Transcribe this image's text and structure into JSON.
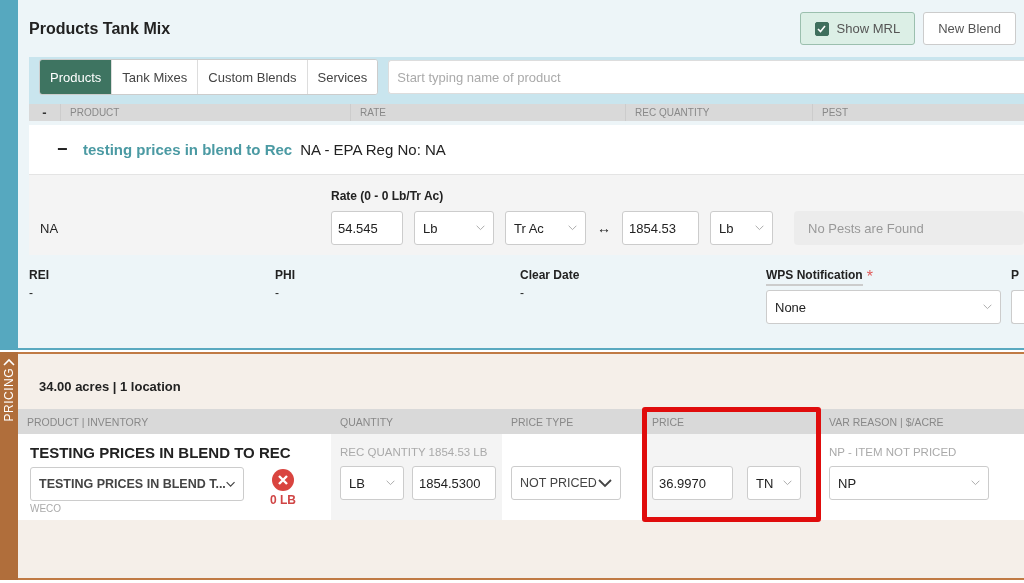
{
  "title": "Products Tank Mix",
  "header_buttons": [
    {
      "kind": "checkbox",
      "label": "Show MRL",
      "checked": true
    },
    {
      "kind": "button",
      "label": "New Blend"
    }
  ],
  "tabs": [
    {
      "label": "Products",
      "selected": true
    },
    {
      "label": "Tank Mixes",
      "selected": false
    },
    {
      "label": "Custom Blends",
      "selected": false
    },
    {
      "label": "Services",
      "selected": false
    }
  ],
  "search": {
    "placeholder": "Start typing name of product"
  },
  "product_table": {
    "collapse": "-",
    "columns": [
      "PRODUCT",
      "RATE",
      "REC QUANTITY",
      "PEST"
    ],
    "group": {
      "toggle": "−",
      "name": "testing prices in blend to Rec",
      "registration": "NA - EPA Reg No: NA"
    },
    "row": {
      "product": "NA",
      "rate_label": "Rate (0 - 0 Lb/Tr Ac)",
      "rate": "54.545",
      "rate_unit": "Lb",
      "area_unit": "Tr Ac",
      "link": "↔",
      "quantity": "1854.53",
      "quantity_unit": "Lb",
      "pests": "No Pests are Found"
    }
  },
  "details": [
    {
      "label": "REI",
      "value": "-"
    },
    {
      "label": "PHI",
      "value": "-"
    },
    {
      "label": "Clear Date",
      "value": "-"
    }
  ],
  "wps": {
    "label": "WPS Notification",
    "required_mark": "*",
    "value": "None"
  },
  "cut_field": {
    "label": "P"
  },
  "pricing": {
    "tab": "PRICING",
    "summary": "34.00 acres | 1 location",
    "columns": [
      {
        "label": "PRODUCT | INVENTORY",
        "highlighted": false
      },
      {
        "label": "QUANTITY",
        "highlighted": false
      },
      {
        "label": "PRICE TYPE",
        "highlighted": false
      },
      {
        "label": "PRICE",
        "highlighted": true
      },
      {
        "label": "VAR REASON | $/ACRE",
        "highlighted": false
      }
    ],
    "row": {
      "name": "TESTING PRICES IN BLEND TO REC",
      "inventory": "TESTING PRICES IN BLEND T...",
      "supplier": "WECO",
      "stock": "0 LB",
      "rec_quantity": "REC QUANTITY 1854.53 LB",
      "quantity_unit": "LB",
      "quantity": "1854.5300",
      "price_type": "NOT PRICED",
      "price": "36.9970",
      "price_unit": "TN",
      "reason_label": "NP - ITEM NOT PRICED",
      "reason": "NP"
    }
  }
}
